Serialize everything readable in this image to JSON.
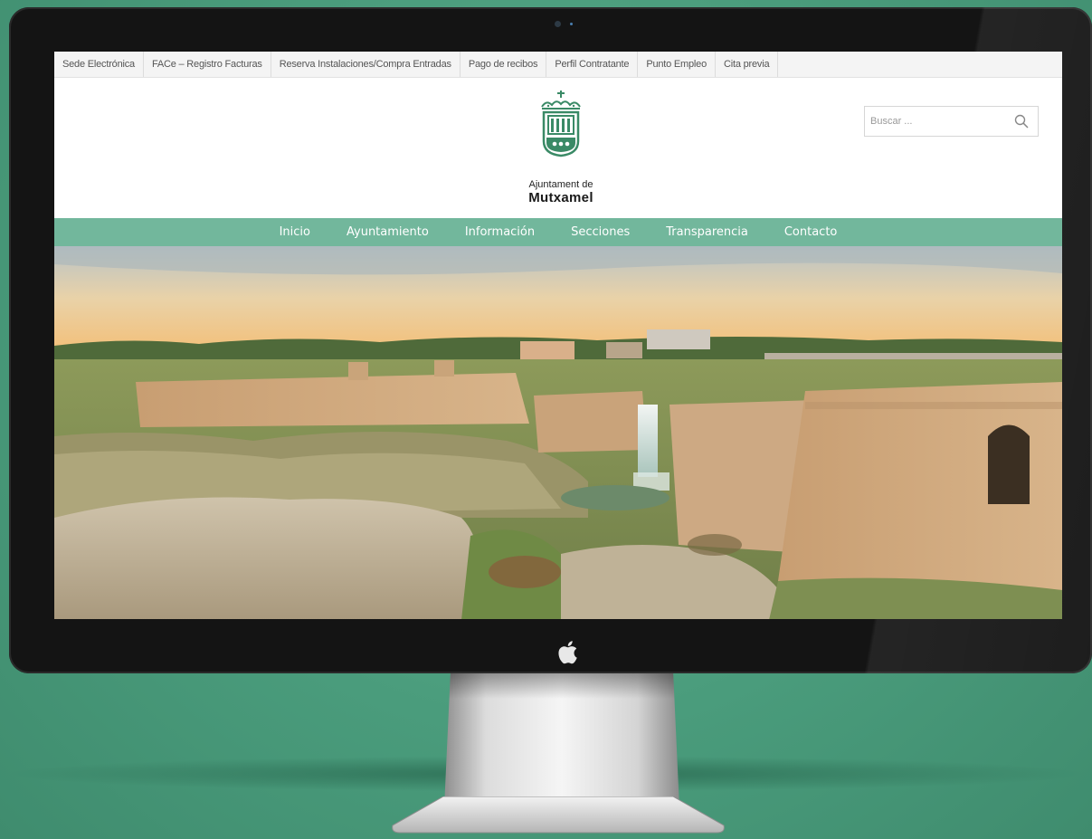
{
  "topbar": {
    "links": [
      "Sede Electrónica",
      "FACe – Registro Facturas",
      "Reserva Instalaciones/Compra Entradas",
      "Pago de recibos",
      "Perfil Contratante",
      "Punto Empleo",
      "Cita previa"
    ]
  },
  "header": {
    "logo_line1": "Ajuntament de",
    "logo_line2": "Mutxamel",
    "search_placeholder": "Buscar ..."
  },
  "nav": {
    "items": [
      "Inicio",
      "Ayuntamiento",
      "Información",
      "Secciones",
      "Transparencia",
      "Contacto"
    ]
  },
  "colors": {
    "background": "#4a9c7c",
    "nav": "#72b79c",
    "brand_green": "#3a8a66"
  },
  "icons": {
    "search": "magnifier",
    "logo": "crowned-shield",
    "device": "apple-logo"
  }
}
